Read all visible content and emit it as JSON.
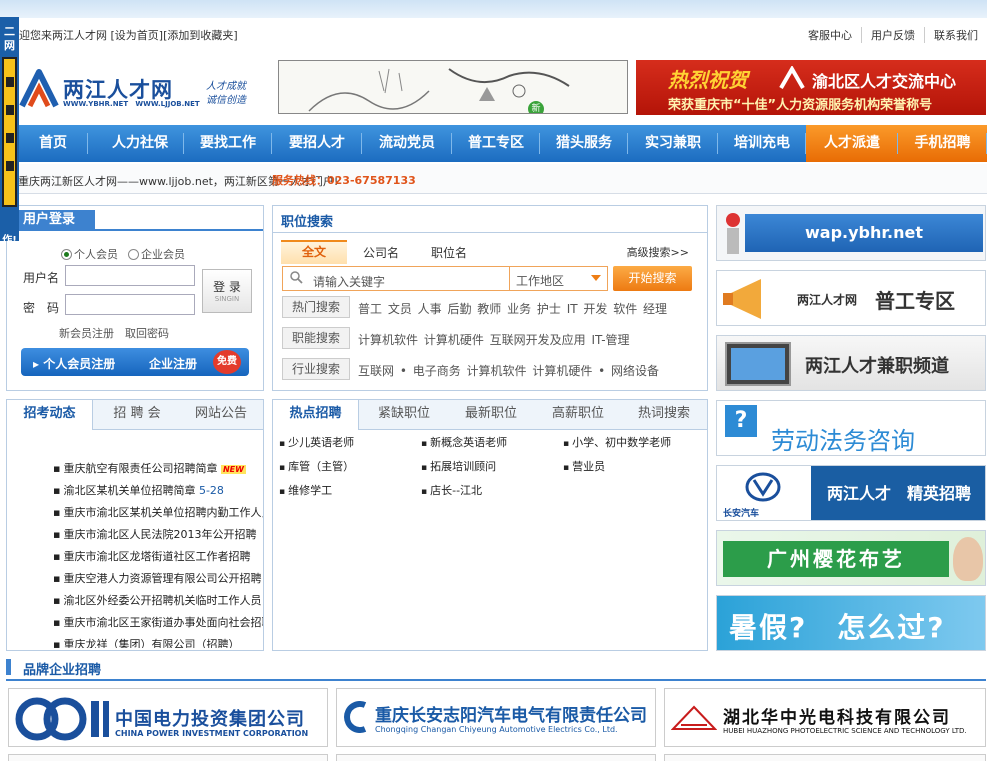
{
  "topbar": {
    "welcome": "迎您来两江人才网 [设为首页][添加到收藏夹]",
    "links": [
      "客服中心",
      "用户反馈",
      "联系我们"
    ]
  },
  "side_float": {
    "line1": "二",
    "line2": "网",
    "line3": "作!"
  },
  "logo": {
    "name": "两江人才网",
    "url1": "WWW.YBHR.NET",
    "url2": "WWW.LJJOB.NET",
    "slogan1": "人才成就",
    "slogan2": "诚信创造"
  },
  "banner_mid": {
    "badge": "新"
  },
  "banner_right": {
    "headline": "热烈祝贺",
    "center": "渝北区人才交流中心",
    "award": "荣获重庆市“十佳”人力资源服务机构荣誉称号"
  },
  "nav": {
    "items": [
      "首页",
      "人力社保",
      "要找工作",
      "要招人才",
      "流动党员",
      "普工专区",
      "猎头服务",
      "实习兼职",
      "培训充电",
      "人才派遣",
      "手机招聘"
    ]
  },
  "subbar": {
    "message": "重庆两江新区人才网——www.ljjob.net，两江新区第一人才门户!",
    "hotline": "服务热线：023-67587133"
  },
  "login": {
    "title": "用户登录",
    "radio_personal": "个人会员",
    "radio_company": "企业会员",
    "username_label": "用户名",
    "password_label": "密　码",
    "login_button": "登 录",
    "login_button_en": "SINGIN",
    "register_links": "新会员注册　取回密码",
    "personal_register": "个人会员注册",
    "company_register": "企业注册",
    "free_badge": "免费"
  },
  "search": {
    "title": "职位搜索",
    "tabs": [
      "全文",
      "公司名",
      "职位名"
    ],
    "advanced": "高级搜索>>",
    "placeholder": "请输入关键字",
    "area": "工作地区",
    "button": "开始搜索",
    "rows": [
      {
        "label": "热门搜索",
        "keywords": "普工 文员 人事 后勤 教师 业务 护士 IT 开发 软件 经理"
      },
      {
        "label": "职能搜索",
        "keywords": "计算机软件 计算机硬件 互联网开发及应用 IT-管理"
      },
      {
        "label": "行业搜索",
        "keywords": "互联网 • 电子商务 计算机软件 计算机硬件 • 网络设备"
      }
    ]
  },
  "right_ads": {
    "wap": "wap.ybhr.net",
    "pugong_small": "两江人才网",
    "pugong_big": "普工专区",
    "parttime": "两江人才兼职频道",
    "labor": "劳动法务咨询",
    "changan_brand": "长安汽车",
    "changan_text": "两江人才　精英招聘",
    "sakura": "广州樱花布艺",
    "summer": "暑假?　怎么过?"
  },
  "news": {
    "tabs": [
      "招考动态",
      "招 聘 会",
      "网站公告"
    ],
    "items": [
      {
        "text": "重庆航空有限责任公司招聘简章",
        "badge": "NEW",
        "date": ""
      },
      {
        "text": "渝北区某机关单位招聘简章",
        "badge": "",
        "date": "5-28"
      },
      {
        "text": "重庆市渝北区某机关单位招聘内勤工作人员",
        "badge": "",
        "date": ""
      },
      {
        "text": "重庆市渝北区人民法院2013年公开招聘",
        "badge": "",
        "date": ""
      },
      {
        "text": "重庆市渝北区龙塔街道社区工作者招聘",
        "badge": "",
        "date": ""
      },
      {
        "text": "重庆空港人力资源管理有限公司公开招聘",
        "badge": "",
        "date": ""
      },
      {
        "text": "渝北区外经委公开招聘机关临时工作人员",
        "badge": "",
        "date": ""
      },
      {
        "text": "重庆市渝北区王家街道办事处面向社会招聘",
        "badge": "",
        "date": ""
      },
      {
        "text": "重庆龙祥（集团）有限公司（招聘）",
        "badge": "",
        "date": ""
      }
    ]
  },
  "hotjobs": {
    "tabs": [
      "热点招聘",
      "紧缺职位",
      "最新职位",
      "高薪职位",
      "热词搜索"
    ],
    "items": [
      "少儿英语老师",
      "新概念英语老师",
      "小学、初中数学老师",
      "库管（主管）",
      "拓展培训顾问",
      "营业员",
      "维修学工",
      "店长--江北"
    ]
  },
  "brand_section": {
    "title": "品牌企业招聘"
  },
  "brands": {
    "b1_cn": "中国电力投资集团公司",
    "b1_en": "CHINA POWER INVESTMENT CORPORATION",
    "b2_cn": "重庆长安志阳汽车电气有限责任公司",
    "b2_en": "Chongqing Changan Chiyeung Automotive Electrics Co., Ltd.",
    "b3_cn": "湖北华中光电科技有限公司",
    "b3_en": "HUBEI HUAZHONG PHOTOELECTRIC SCIENCE AND TECHNOLOGY LTD."
  },
  "colors": {
    "primary": "#1c6cc0",
    "accent": "#ed7a12",
    "brand_red": "#c41a0c"
  }
}
